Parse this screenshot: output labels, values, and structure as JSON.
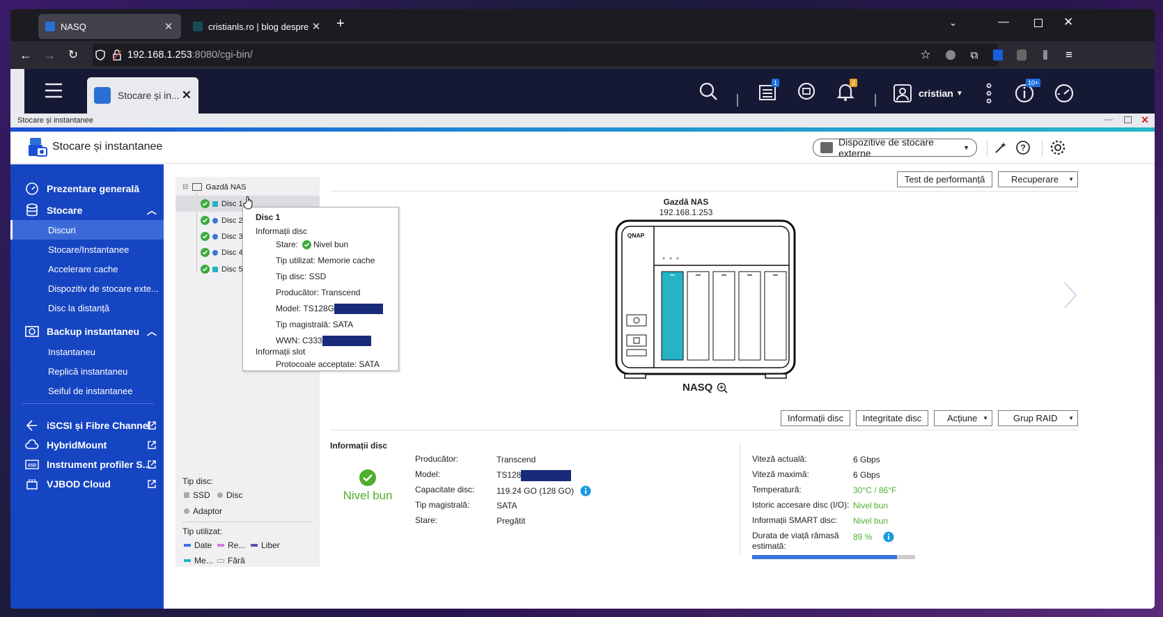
{
  "browser": {
    "tabs": [
      {
        "title": "NASQ",
        "active": true
      },
      {
        "title": "cristianls.ro | blog despre ce-mi",
        "active": false
      }
    ],
    "url_host": "192.168.1.253",
    "url_rest": ":8080/cgi-bin/"
  },
  "qnap_top": {
    "app_tab_label": "Stocare și in...",
    "badge_tasks": "1",
    "badge_notifications": "2",
    "user": "cristian",
    "badge_updates": "10+"
  },
  "window": {
    "title": "Stocare și instantanee",
    "app_title": "Stocare și instantanee",
    "external_devices_label": "Dispozitive de stocare externe"
  },
  "sidebar": {
    "sections": [
      {
        "label": "Prezentare generală",
        "icon": "dashboard-icon"
      },
      {
        "label": "Stocare",
        "icon": "database-icon",
        "items": [
          "Discuri",
          "Stocare/Instantanee",
          "Accelerare cache",
          "Dispozitiv de stocare exte...",
          "Disc la distanță"
        ]
      },
      {
        "label": "Backup instantaneu",
        "icon": "snapshot-icon",
        "items": [
          "Instantaneu",
          "Replică instantaneu",
          "Seiful de instantanee"
        ]
      },
      {
        "label": "iSCSI și Fibre Channel",
        "icon": "iscsi-icon"
      },
      {
        "label": "HybridMount",
        "icon": "hybridmount-icon"
      },
      {
        "label": "Instrument profiler S...",
        "icon": "ssd-icon"
      },
      {
        "label": "VJBOD Cloud",
        "icon": "vjbod-icon"
      }
    ]
  },
  "tree": {
    "root": "Gazdă NAS",
    "disks": [
      "Disc 1",
      "Disc 2",
      "Disc 3",
      "Disc 4",
      "Disc 5"
    ],
    "legend_disk_type_title": "Tip disc:",
    "legend_ssd": "SSD",
    "legend_disc": "Disc",
    "legend_adaptor": "Adaptor",
    "legend_usage_title": "Tip utilizat:",
    "legend_date": "Date",
    "legend_re": "Re...",
    "legend_liber": "Liber",
    "legend_me": "Me...",
    "legend_fara": "Fără"
  },
  "tooltip": {
    "title": "Disc 1",
    "section_disk": "Informații disc",
    "stare_label": "Stare:",
    "stare_value": "Nivel bun",
    "tip_utilizat_label": "Tip utilizat:",
    "tip_utilizat_value": "Memorie cache",
    "tip_disc_label": "Tip disc:",
    "tip_disc_value": "SSD",
    "producator_label": "Producător:",
    "producator_value": "Transcend",
    "model_label": "Model:",
    "model_value": "TS128G",
    "magistrala_label": "Tip magistrală:",
    "magistrala_value": "SATA",
    "wwn_label": "WWN:",
    "wwn_value": "C333",
    "section_slot": "Informații slot",
    "protocoale_label": "Protocoale acceptate:",
    "protocoale_value": "SATA"
  },
  "main": {
    "btn_test": "Test de performanță",
    "btn_recuperare": "Recuperare",
    "nas_title": "Gazdă NAS",
    "nas_ip": "192.168.1.253",
    "nas_name": "NASQ",
    "btn_info": "Informații disc",
    "btn_integritate": "Integritate disc",
    "btn_actiune": "Acțiune",
    "btn_raid": "Grup RAID",
    "info_title": "Informații disc",
    "status": "Nivel bun",
    "left_info": [
      {
        "label": "Producător:",
        "value": "Transcend"
      },
      {
        "label": "Model:",
        "value": "TS128"
      },
      {
        "label": "Capacitate disc:",
        "value": "119.24 GO (128 GO)"
      },
      {
        "label": "Tip magistrală:",
        "value": "SATA"
      },
      {
        "label": "Stare:",
        "value": "Pregătit"
      }
    ],
    "right_info": [
      {
        "label": "Viteză actuală:",
        "value": "6 Gbps"
      },
      {
        "label": "Viteză maximă:",
        "value": "6 Gbps"
      },
      {
        "label": "Temperatură:",
        "value": "30°C / 86°F"
      },
      {
        "label": "Istoric accesare disc (I/O):",
        "value": "Nivel bun"
      },
      {
        "label": "Informații SMART disc:",
        "value": "Nivel bun"
      }
    ],
    "life_label_1": "Durata de viață rămasă",
    "life_label_2": "estimată:",
    "life_value": "89 %",
    "life_fraction": 0.89
  },
  "colors": {
    "sidebar": "#1645c2",
    "accent_green": "#4fae2e",
    "slot_cache": "#25b3c5",
    "progress": "#3a74d8"
  }
}
